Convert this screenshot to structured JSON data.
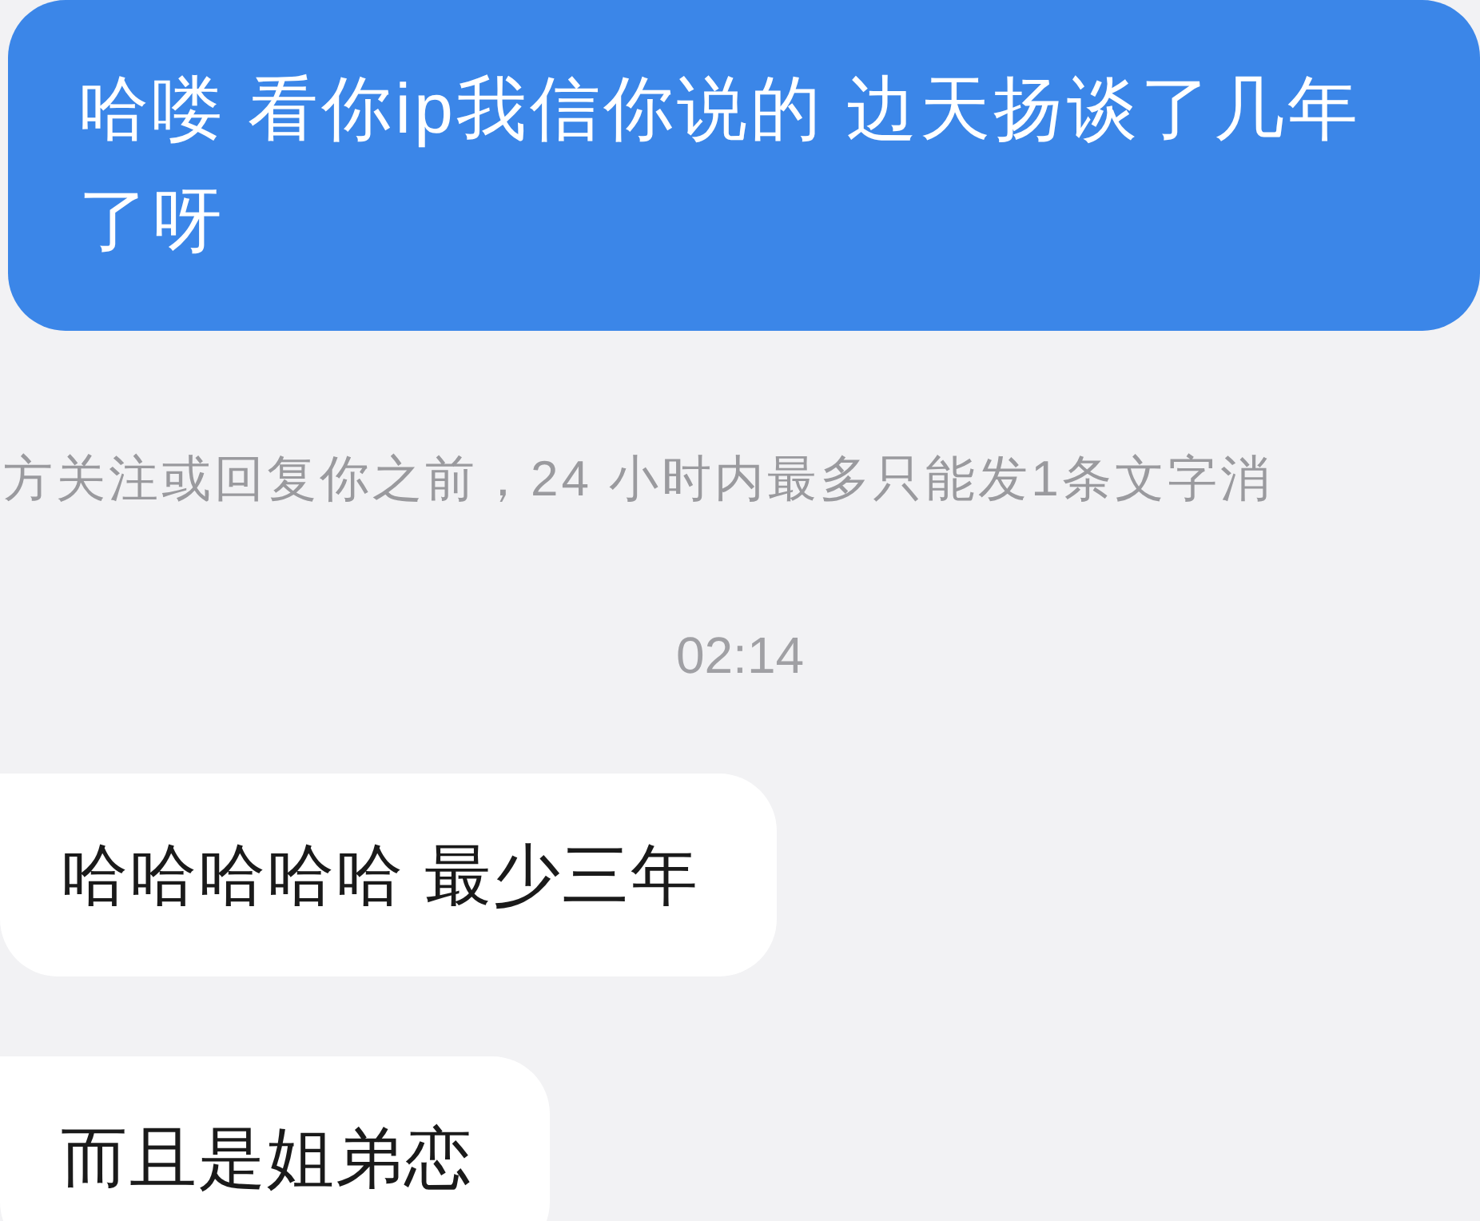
{
  "messages": [
    {
      "kind": "sent",
      "text": "哈喽 看你ip我信你说的 边天扬谈了几年了呀"
    },
    {
      "kind": "notice",
      "text": "方关注或回复你之前，24 小时内最多只能发1条文字消"
    },
    {
      "kind": "time",
      "text": "02:14"
    },
    {
      "kind": "received",
      "text": "哈哈哈哈哈 最少三年"
    },
    {
      "kind": "received",
      "text": "而且是姐弟恋"
    }
  ]
}
